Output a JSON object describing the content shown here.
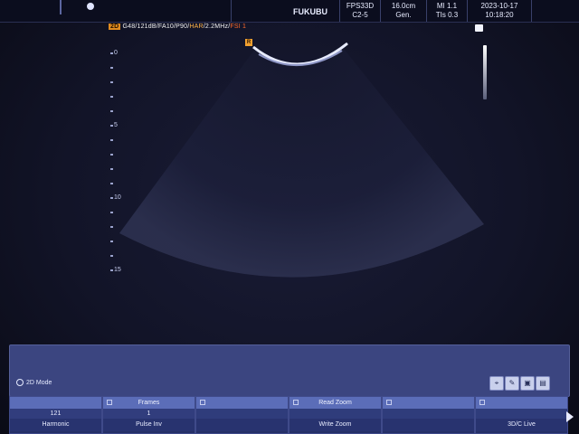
{
  "header": {
    "hospital": "FUKUBU",
    "probe": {
      "line1": "FPS33D",
      "line2": "C2-5"
    },
    "depth": {
      "line1": "16.0cm",
      "line2": "Gen."
    },
    "index": {
      "line1": "MI 1.1",
      "line2": "TIs 0.3"
    },
    "datetime": {
      "date": "2023-10-17",
      "time": "10:18:20"
    }
  },
  "params": {
    "mode": "2D",
    "text": "G48/121dB/FA10/P90/",
    "har": "HAR",
    "freq": "/2.2MHz/",
    "fsi": "FSI 1"
  },
  "probe_marker": "R",
  "depth_scale": {
    "labels": [
      "0",
      "5",
      "10",
      "15"
    ]
  },
  "mode_panel": {
    "label": "2D Mode"
  },
  "tool_icons": [
    "measure-icon",
    "annotate-icon",
    "save-icon",
    "print-icon"
  ],
  "softkeys": [
    {
      "top": "",
      "mid": "121",
      "bottom": "Harmonic"
    },
    {
      "top": "Frames",
      "mid": "1",
      "bottom": "Pulse Inv"
    },
    {
      "top": "",
      "mid": "",
      "bottom": ""
    },
    {
      "top": "Read Zoom",
      "mid": "",
      "bottom": "Write Zoom"
    },
    {
      "top": "",
      "mid": "",
      "bottom": ""
    },
    {
      "top": "",
      "mid": "",
      "bottom": "3D/C Live"
    }
  ],
  "colors": {
    "accent_orange": "#e08b1f",
    "panel_blue": "#3b4580",
    "softkey_blue": "#5b6db8"
  }
}
